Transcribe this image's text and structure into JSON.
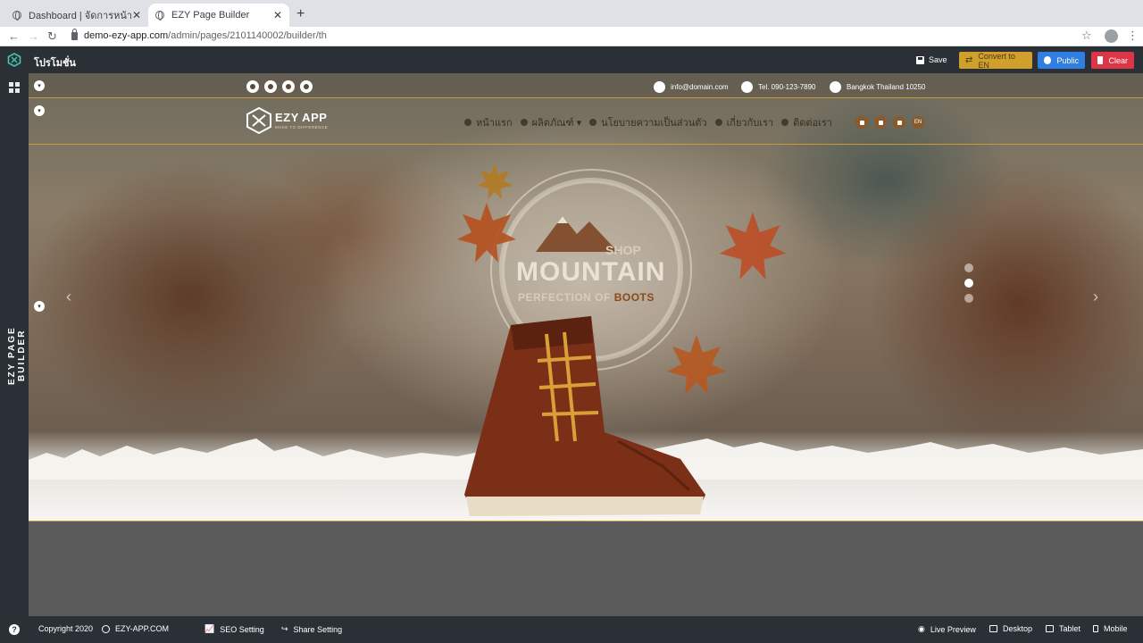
{
  "browser": {
    "tabs": [
      {
        "title": "Dashboard | จัดการหน้า"
      },
      {
        "title": "EZY Page Builder"
      }
    ],
    "url_host": "demo-ezy-app.com",
    "url_path": "/admin/pages/2101140002/builder/th"
  },
  "builder": {
    "page_name": "โปรโมชั่น",
    "save_label": "Save",
    "convert_label": "Convert to EN",
    "public_label": "Public",
    "clear_label": "Clear",
    "rail_label": "EZY PAGE BUILDER"
  },
  "site": {
    "contact": {
      "email": "info@domain.com",
      "phone": "Tel. 090-123-7890",
      "address": "Bangkok Thailand 10250"
    },
    "brand": {
      "name": "EZY APP",
      "tagline": "MAKE TO DIFFERENCE"
    },
    "menu": [
      {
        "label": "หน้าแรก"
      },
      {
        "label": "ผลิตภัณฑ์ ▾"
      },
      {
        "label": "นโยบายความเป็นส่วนตัว"
      },
      {
        "label": "เกี่ยวกับเรา"
      },
      {
        "label": "ติดต่อเรา"
      }
    ],
    "lang_label": "EN",
    "hero": {
      "shop": "SHOP",
      "title": "MOUNTAIN",
      "subtitle_a": "PERFECTION OF",
      "subtitle_b": "BOOTS",
      "slide_count": 3,
      "active_slide": 2
    }
  },
  "footer": {
    "copyright": "Copyright 2020",
    "site": "EZY-APP.COM",
    "seo": "SEO Setting",
    "share": "Share Setting",
    "live_preview": "Live Preview",
    "desktop": "Desktop",
    "tablet": "Tablet",
    "mobile": "Mobile"
  },
  "colors": {
    "accent_gold": "#c99a3b",
    "public_blue": "#2f7ee0",
    "clear_red": "#dc3545",
    "convert_gold": "#d1a02c",
    "dark_panel": "#2b3036"
  }
}
